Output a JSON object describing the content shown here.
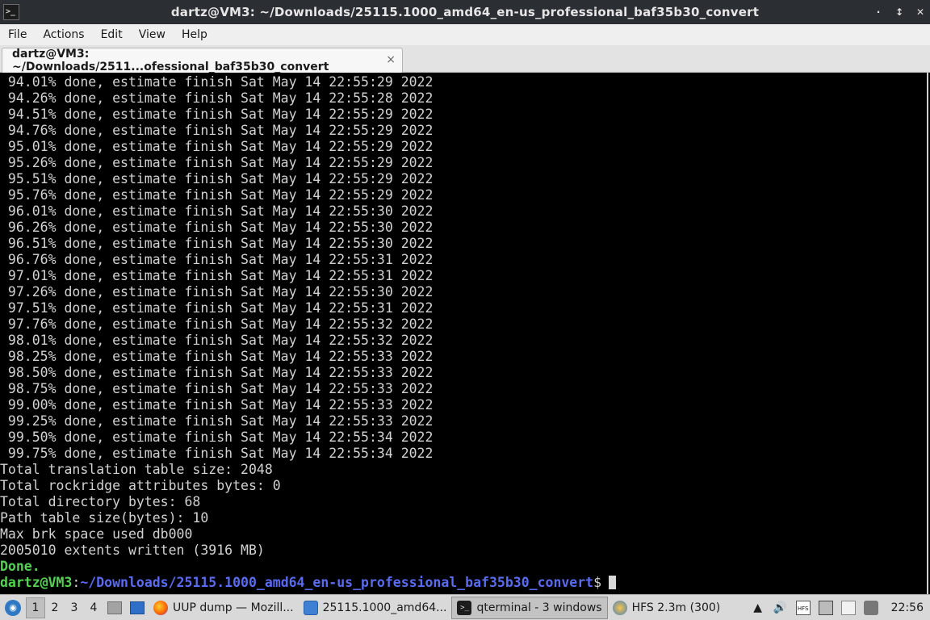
{
  "window": {
    "title": "dartz@VM3: ~/Downloads/25115.1000_amd64_en-us_professional_baf35b30_convert",
    "app_icon": ">_",
    "wm_buttons": [
      "·",
      "↕",
      "✕"
    ]
  },
  "menu": [
    "File",
    "Actions",
    "Edit",
    "View",
    "Help"
  ],
  "tab": {
    "label": "dartz@VM3: ~/Downloads/2511...ofessional_baf35b30_convert",
    "close": "×"
  },
  "terminal": {
    "progress_lines": [
      " 94.01% done, estimate finish Sat May 14 22:55:29 2022",
      " 94.26% done, estimate finish Sat May 14 22:55:28 2022",
      " 94.51% done, estimate finish Sat May 14 22:55:29 2022",
      " 94.76% done, estimate finish Sat May 14 22:55:29 2022",
      " 95.01% done, estimate finish Sat May 14 22:55:29 2022",
      " 95.26% done, estimate finish Sat May 14 22:55:29 2022",
      " 95.51% done, estimate finish Sat May 14 22:55:29 2022",
      " 95.76% done, estimate finish Sat May 14 22:55:29 2022",
      " 96.01% done, estimate finish Sat May 14 22:55:30 2022",
      " 96.26% done, estimate finish Sat May 14 22:55:30 2022",
      " 96.51% done, estimate finish Sat May 14 22:55:30 2022",
      " 96.76% done, estimate finish Sat May 14 22:55:31 2022",
      " 97.01% done, estimate finish Sat May 14 22:55:31 2022",
      " 97.26% done, estimate finish Sat May 14 22:55:30 2022",
      " 97.51% done, estimate finish Sat May 14 22:55:31 2022",
      " 97.76% done, estimate finish Sat May 14 22:55:32 2022",
      " 98.01% done, estimate finish Sat May 14 22:55:32 2022",
      " 98.25% done, estimate finish Sat May 14 22:55:33 2022",
      " 98.50% done, estimate finish Sat May 14 22:55:33 2022",
      " 98.75% done, estimate finish Sat May 14 22:55:33 2022",
      " 99.00% done, estimate finish Sat May 14 22:55:33 2022",
      " 99.25% done, estimate finish Sat May 14 22:55:33 2022",
      " 99.50% done, estimate finish Sat May 14 22:55:34 2022",
      " 99.75% done, estimate finish Sat May 14 22:55:34 2022"
    ],
    "summary_lines": [
      "Total translation table size: 2048",
      "Total rockridge attributes bytes: 0",
      "Total directory bytes: 68",
      "Path table size(bytes): 10",
      "Max brk space used db000",
      "2005010 extents written (3916 MB)"
    ],
    "done_text": "Done.",
    "prompt_user": "dartz@VM3",
    "prompt_sep": ":",
    "prompt_path": "~/Downloads/25115.1000_amd64_en-us_professional_baf35b30_convert",
    "prompt_symbol": "$"
  },
  "taskbar": {
    "desktops": [
      "1",
      "2",
      "3",
      "4"
    ],
    "active_desktop": "1",
    "tasks": [
      {
        "label": "UUP dump — Mozill...",
        "icon": "firefox-icon"
      },
      {
        "label": "25115.1000_amd64...",
        "icon": "folder-icon"
      },
      {
        "label": "qterminal - 3 windows",
        "icon": "terminal-icon"
      },
      {
        "label": "HFS 2.3m (300)",
        "icon": "hfs-icon"
      }
    ],
    "clock": "22:56"
  },
  "colors": {
    "terminal_bg": "#000000",
    "terminal_fg": "#d2d2d2",
    "prompt_green": "#54d154",
    "prompt_blue": "#5b6bf0",
    "titlebar_bg": "#2b2e33"
  }
}
